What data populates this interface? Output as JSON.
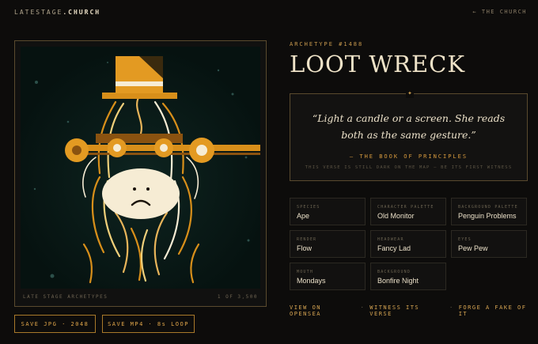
{
  "header": {
    "brand_main": "LATESTAGE",
    "brand_tld": ".CHURCH",
    "back_link": "← THE CHURCH"
  },
  "artwork": {
    "footer_left": "LATE STAGE ARCHETYPES",
    "footer_right": "1 OF 3,500",
    "icons": [
      "top-hat-icon",
      "ape-face-icon",
      "glasses-icon",
      "feather-fur-icon"
    ],
    "colors": {
      "background": "#071512",
      "gold": "#d88f1a",
      "cream": "#f6ecd4"
    }
  },
  "buttons": {
    "save_jpg": "SAVE JPG · 2048",
    "save_mp4": "SAVE MP4 · 8s LOOP"
  },
  "detail": {
    "archetype": "ARCHETYPE #1488",
    "title": "LOOT WRECK",
    "quote": "“Light a candle or a screen. She reads both as the same gesture.”",
    "quote_source": "— THE BOOK OF PRINCIPLES",
    "quote_note": "THIS VERSE IS STILL DARK ON THE MAP — BE ITS FIRST WITNESS"
  },
  "traits": [
    {
      "label": "SPECIES",
      "value": "Ape"
    },
    {
      "label": "CHARACTER PALETTE",
      "value": "Old Monitor"
    },
    {
      "label": "BACKGROUND PALETTE",
      "value": "Penguin Problems"
    },
    {
      "label": "RENDER",
      "value": "Flow"
    },
    {
      "label": "HEADWEAR",
      "value": "Fancy Lad"
    },
    {
      "label": "EYES",
      "value": "Pew Pew"
    },
    {
      "label": "MOUTH",
      "value": "Mondays"
    },
    {
      "label": "BACKGROUND",
      "value": "Bonfire Night"
    }
  ],
  "actions": {
    "opensea": "VIEW ON OPENSEA",
    "witness": "WITNESS ITS VERSE",
    "forge": "FORGE A FAKE OF IT",
    "separator": "·"
  },
  "theme": {
    "accent": "#d7a552",
    "page_bg": "#0d0c0b",
    "border": "#5a4a2e"
  }
}
